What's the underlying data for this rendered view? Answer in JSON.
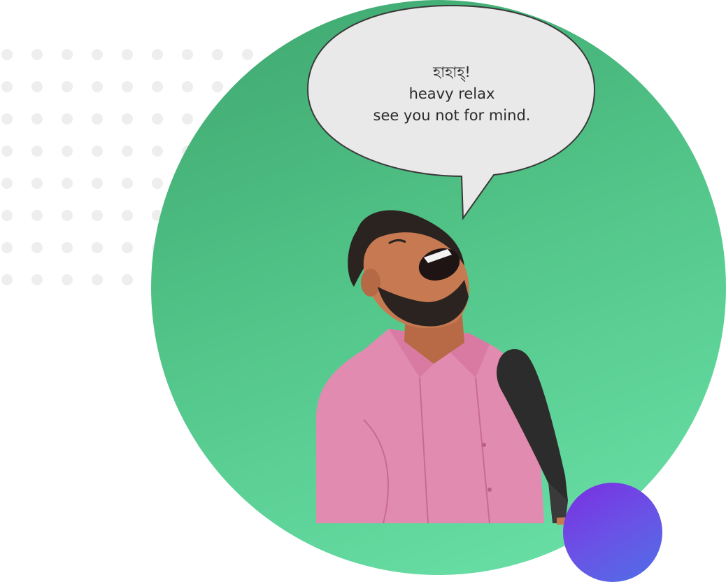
{
  "speech_bubble": {
    "line1": "হাহাহ্!",
    "line2": "heavy relax",
    "line3": "see you not for mind."
  },
  "colors": {
    "circle_start": "#3ea66e",
    "circle_end": "#6be3aa",
    "accent_start": "#7a2ee0",
    "accent_end": "#4f6fe6",
    "dots": "#eeeeee",
    "shirt": "#e28bb0",
    "skin": "#c77a52",
    "beard": "#2a2320",
    "microphone": "#2c2c2c"
  },
  "icons": {
    "dot_grid": "decorative-dot-grid",
    "illustration": "laughing-man-illustration",
    "microphone": "microphone-icon"
  }
}
